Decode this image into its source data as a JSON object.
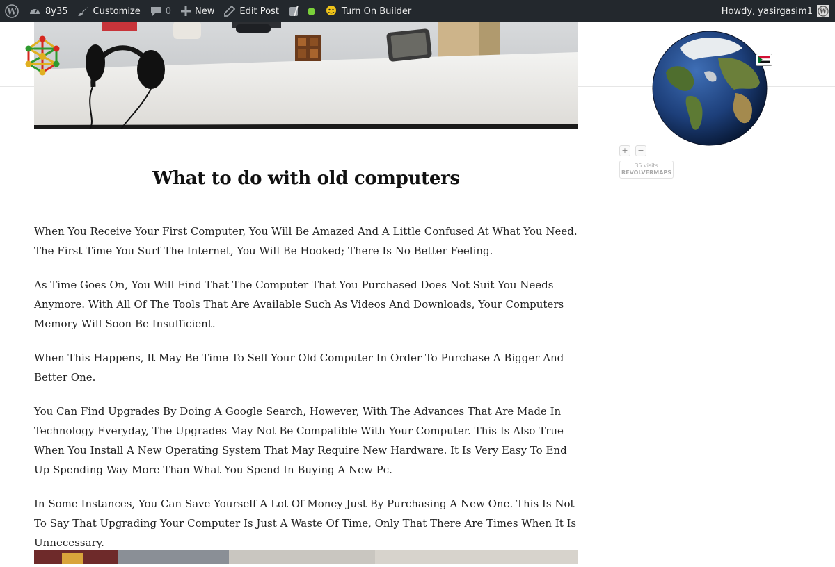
{
  "adminbar": {
    "site_name": "8y35",
    "customize_label": "Customize",
    "comments_count": "0",
    "new_label": "New",
    "edit_post_label": "Edit Post",
    "builder_label": "Turn On Builder",
    "howdy_label": "Howdy, yasirgasim1",
    "icons": [
      "wordpress-icon",
      "dashboard-icon",
      "brush-icon",
      "comment-icon",
      "plus-icon",
      "pencil-icon",
      "yoast-icon",
      "status-dot-icon",
      "builder-icon",
      "avatar-icon"
    ],
    "colors": {
      "background": "#23282d",
      "text": "#eeeeee",
      "status_dot": "#7ad03a"
    }
  },
  "post": {
    "title": "What to do with old computers",
    "paragraphs": [
      "When You Receive Your First Computer, You Will Be Amazed And A Little Confused At What You Need. The First Time You Surf The Internet, You Will Be Hooked; There Is No Better Feeling.",
      "As Time Goes On, You Will Find That The Computer That You Purchased Does Not Suit You Needs Anymore. With All Of The Tools That Are Available Such As Videos And Downloads, Your Computers Memory Will Soon Be Insufficient.",
      "When This Happens, It May Be Time To Sell Your Old Computer In Order To Purchase A Bigger And Better One.",
      "You Can Find Upgrades By Doing A Google Search, However, With The Advances That Are Made In Technology Everyday, The Upgrades May Not Be Compatible With Your Computer. This Is Also True When You Install A New Operating System That May Require New Hardware. It Is Very Easy To End Up Spending Way More Than What You Spend In Buying A New Pc.",
      "In Some Instances, You Can Save Yourself A Lot Of Money Just By Purchasing A New One. This Is Not To Say That Upgrading Your Computer Is Just A Waste Of Time, Only That There Are Times When It Is Unnecessary."
    ]
  },
  "widget": {
    "zoom_in": "+",
    "zoom_out": "−",
    "visits": "35 visits",
    "brand": "REVOLVERMAPS"
  }
}
